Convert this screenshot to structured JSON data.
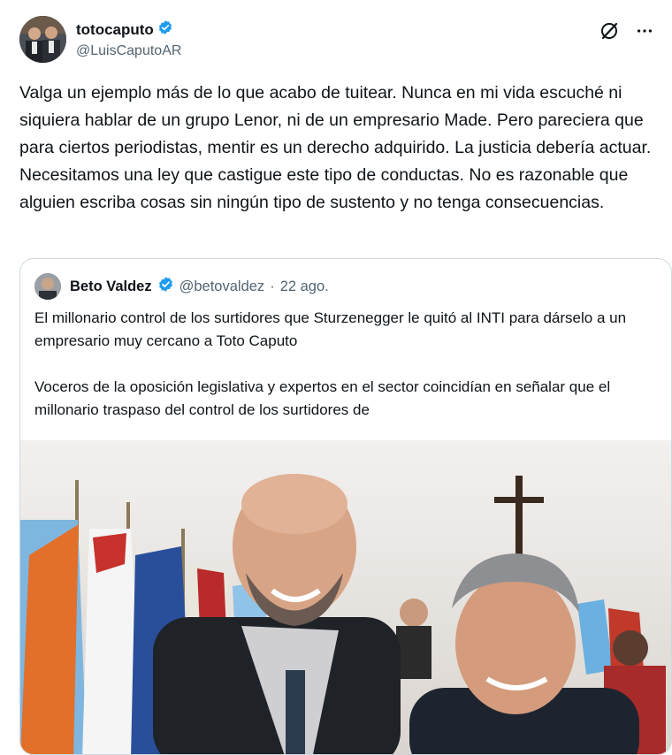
{
  "author": {
    "display_name": "totocaputo",
    "handle": "@LuisCaputoAR",
    "avatar_icon": "user-avatar"
  },
  "actions": {
    "grok_icon": "grok-icon",
    "more_icon": "more-options-icon"
  },
  "tweet": {
    "text": "Valga un ejemplo más de lo que acabo de tuitear. Nunca en mi vida escuché ni siquiera hablar de un grupo Lenor, ni de un empresario Made. Pero pareciera que para ciertos periodistas, mentir es un derecho adquirido. La justicia debería actuar. Necesitamos una ley que castigue este tipo de conductas. No es razonable que alguien escriba cosas sin ningún tipo de sustento y no tenga consecuencias."
  },
  "quoted": {
    "display_name": "Beto Valdez",
    "handle": "@betovaldez",
    "separator": "·",
    "date": "22 ago.",
    "paragraph_1": "El millonario control de los surtidores que Sturzenegger le quitó al INTI para dárselo a un empresario muy cercano a Toto Caputo",
    "paragraph_2": "Voceros de la oposición legislativa y expertos en el sector coincidían en señalar que el millonario traspaso del control de los surtidores de"
  },
  "colors": {
    "text": "#0f1419",
    "secondary": "#536471",
    "verified": "#1d9bf0",
    "border": "#cfd9de"
  }
}
